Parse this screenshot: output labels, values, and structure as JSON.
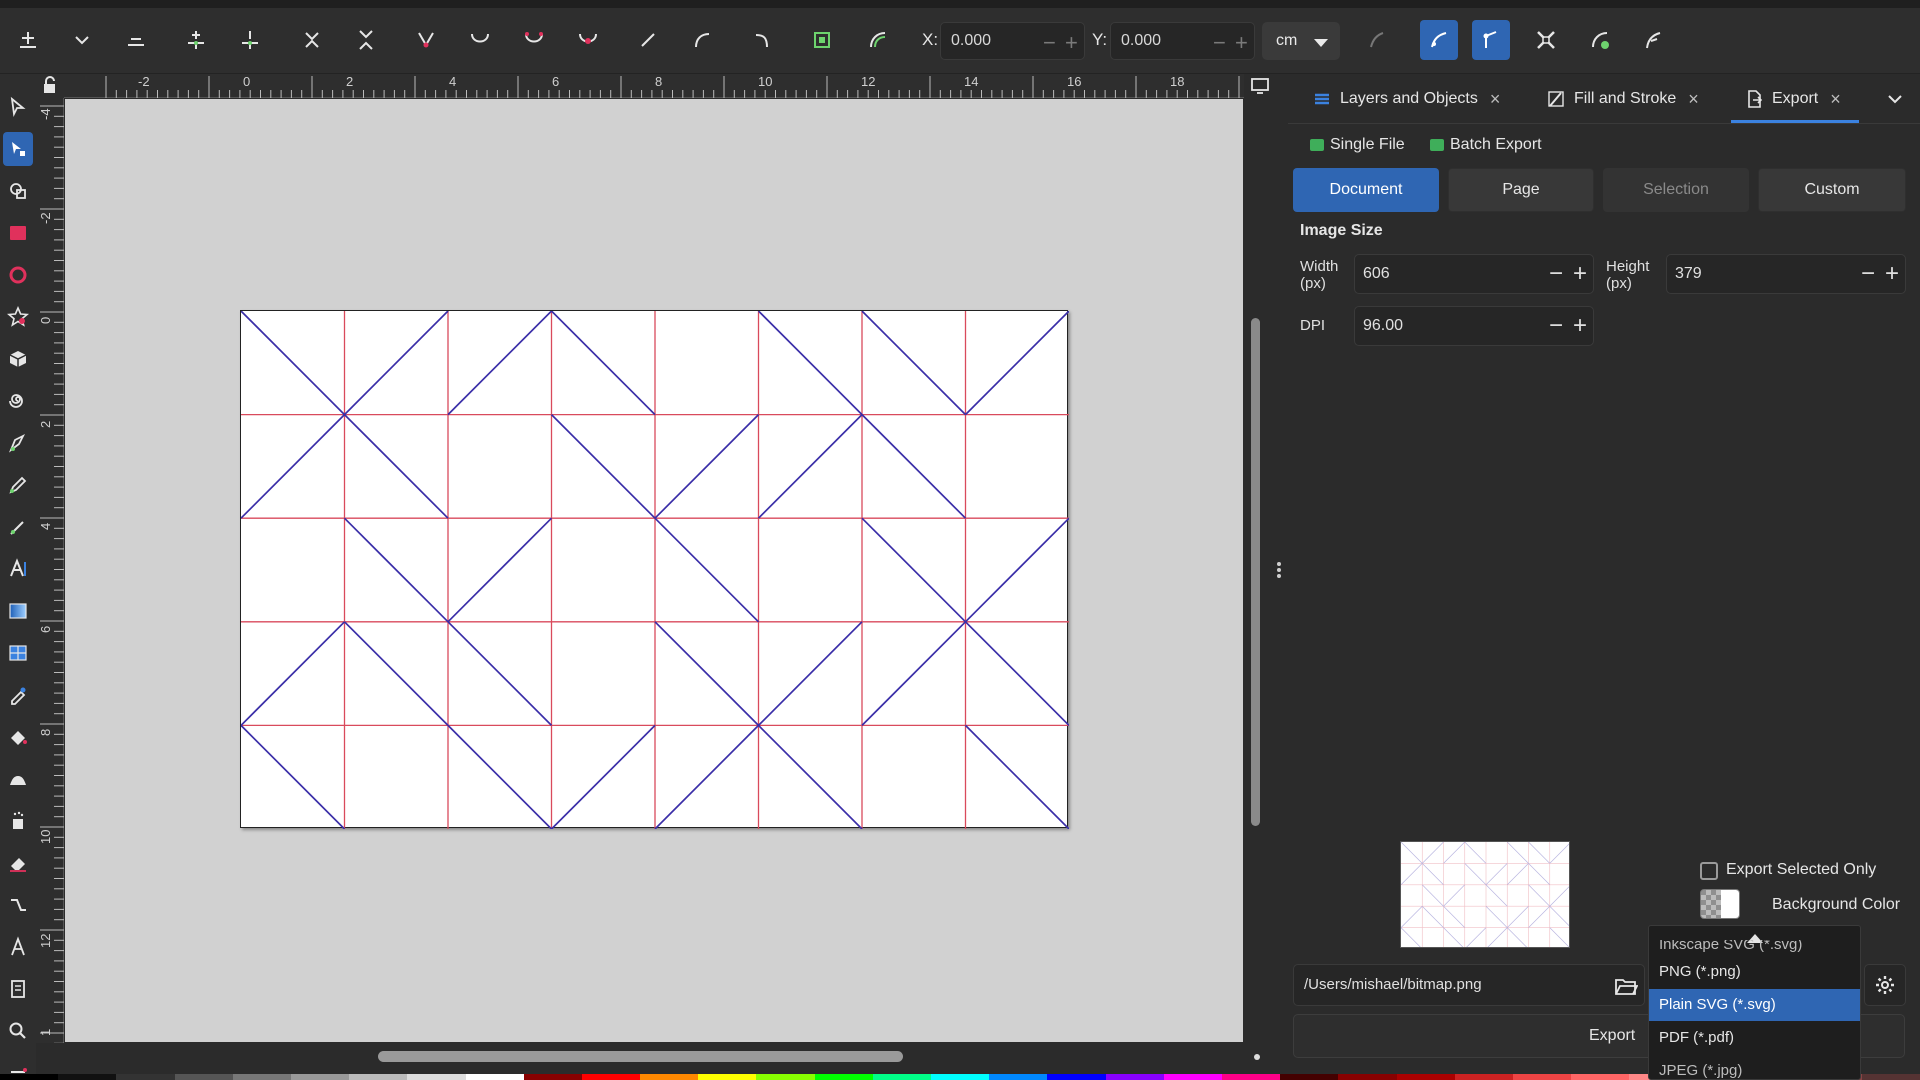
{
  "toolbar": {
    "x_label": "X:",
    "x_value": "0.000",
    "y_label": "Y:",
    "y_value": "0.000",
    "minus": "−",
    "plus": "+",
    "unit": "cm"
  },
  "ruler": {
    "top_ticks": [
      "-2",
      "0",
      "2",
      "4",
      "6",
      "8",
      "10",
      "12",
      "14",
      "16",
      "18"
    ],
    "left_ticks": [
      "-4",
      "-2",
      "0",
      "2",
      "4",
      "6",
      "8",
      "10",
      "12",
      "1"
    ]
  },
  "dock": {
    "tabs": [
      {
        "label": "Layers and Objects",
        "close": "×"
      },
      {
        "label": "Fill and Stroke",
        "close": "×"
      },
      {
        "label": "Export",
        "close": "×"
      }
    ],
    "subtabs": [
      {
        "label": "Single File"
      },
      {
        "label": "Batch Export"
      }
    ],
    "area_buttons": [
      "Document",
      "Page",
      "Selection",
      "Custom"
    ],
    "image_size_title": "Image Size",
    "width_label": "Width\n(px)",
    "width_value": "606",
    "height_label": "Height\n(px)",
    "height_value": "379",
    "dpi_label": "DPI",
    "dpi_value": "96.00",
    "minus": "−",
    "plus": "+",
    "export_selected_only": "Export Selected Only",
    "background_color": "Background Color",
    "file_path": "/Users/mishael/bitmap.png",
    "export_button": "Export"
  },
  "format_dropdown": {
    "partial_item": "Inkscape SVG (*.svg)",
    "items": [
      "PNG (*.png)",
      "Plain SVG (*.svg)",
      "PDF (*.pdf)",
      "JPEG (*.jpg)"
    ],
    "selected": "Plain SVG (*.svg)"
  },
  "colors": {
    "accent": "#2f66b3",
    "grid_red": "#d94a5c",
    "diagonal_blue": "#3a2ea8"
  }
}
